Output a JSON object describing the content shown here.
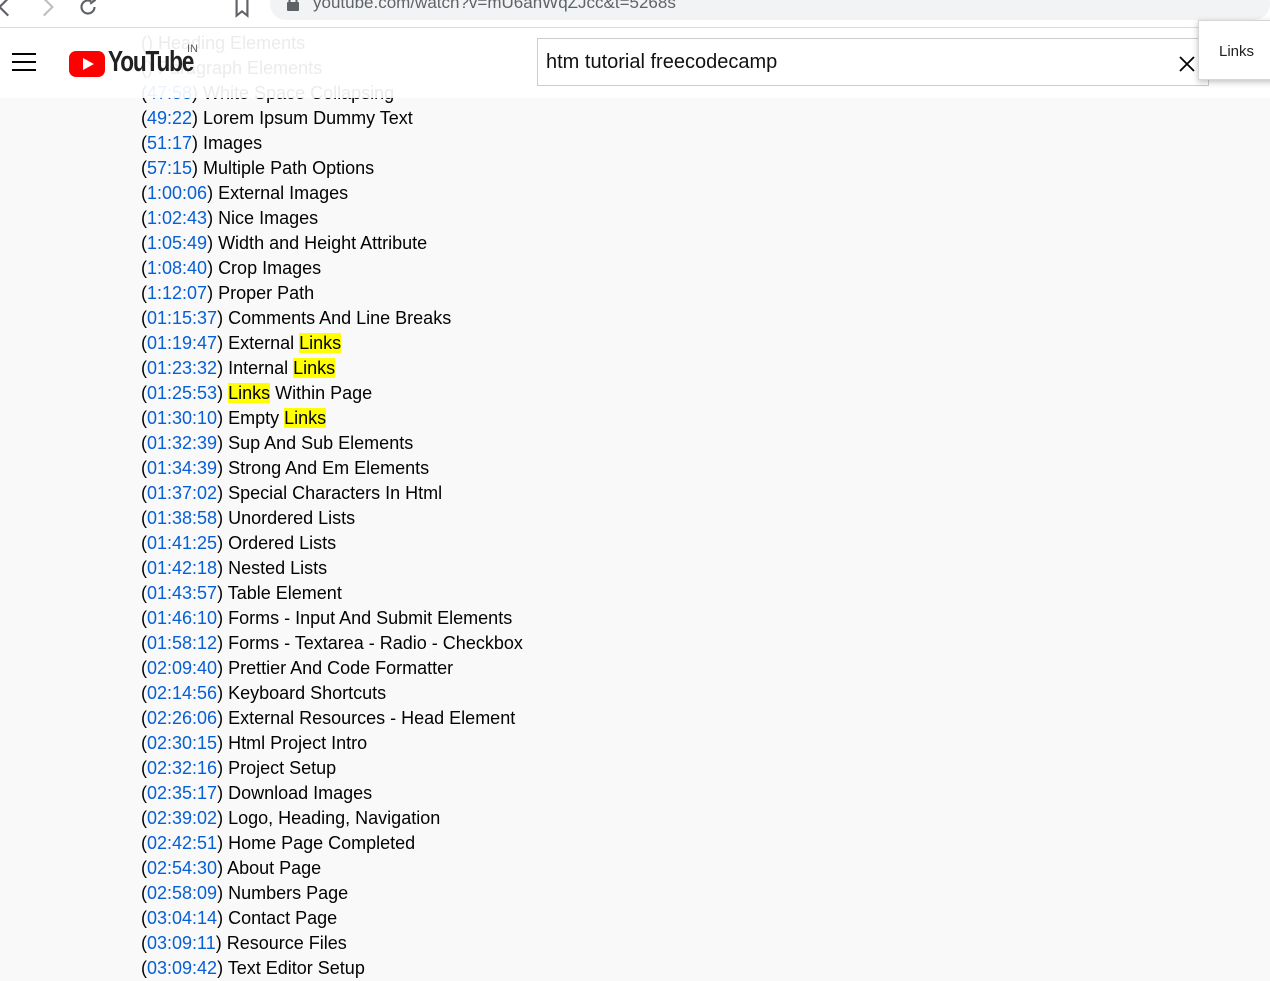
{
  "browser": {
    "url": "youtube.com/watch?v=mU6anWqZJcc&t=5268s"
  },
  "header": {
    "logo_text": "YouTube",
    "country_code": "IN",
    "search_value": "htm tutorial freecodecamp"
  },
  "find": {
    "query": "Links"
  },
  "chapters": [
    {
      "ts": "",
      "title": "Heading Elements"
    },
    {
      "ts": "",
      "title": "Paragraph Elements"
    },
    {
      "ts": "47:58",
      "title": "White Space Collapsing"
    },
    {
      "ts": "49:22",
      "title": "Lorem Ipsum Dummy Text"
    },
    {
      "ts": "51:17",
      "title": "Images"
    },
    {
      "ts": "57:15",
      "title": "Multiple Path Options"
    },
    {
      "ts": "1:00:06",
      "title": "External Images"
    },
    {
      "ts": "1:02:43",
      "title": "Nice Images"
    },
    {
      "ts": "1:05:49",
      "title": "Width and Height Attribute"
    },
    {
      "ts": "1:08:40",
      "title": "Crop Images"
    },
    {
      "ts": "1:12:07",
      "title": "Proper Path"
    },
    {
      "ts": "01:15:37",
      "title": "Comments And Line Breaks"
    },
    {
      "ts": "01:19:47",
      "title": "External Links"
    },
    {
      "ts": "01:23:32",
      "title": "Internal Links"
    },
    {
      "ts": "01:25:53",
      "title": "Links Within Page"
    },
    {
      "ts": "01:30:10",
      "title": "Empty Links"
    },
    {
      "ts": "01:32:39",
      "title": "Sup And Sub Elements"
    },
    {
      "ts": "01:34:39",
      "title": "Strong And Em Elements"
    },
    {
      "ts": "01:37:02",
      "title": "Special Characters In Html"
    },
    {
      "ts": "01:38:58",
      "title": "Unordered Lists"
    },
    {
      "ts": "01:41:25",
      "title": "Ordered Lists"
    },
    {
      "ts": "01:42:18",
      "title": "Nested Lists"
    },
    {
      "ts": "01:43:57",
      "title": "Table Element"
    },
    {
      "ts": "01:46:10",
      "title": "Forms - Input And Submit Elements"
    },
    {
      "ts": "01:58:12",
      "title": "Forms - Textarea - Radio - Checkbox"
    },
    {
      "ts": "02:09:40",
      "title": "Prettier And Code Formatter"
    },
    {
      "ts": "02:14:56",
      "title": "Keyboard Shortcuts"
    },
    {
      "ts": "02:26:06",
      "title": "External Resources - Head Element"
    },
    {
      "ts": "02:30:15",
      "title": "Html Project Intro"
    },
    {
      "ts": "02:32:16",
      "title": "Project Setup"
    },
    {
      "ts": "02:35:17",
      "title": "Download Images"
    },
    {
      "ts": "02:39:02",
      "title": "Logo, Heading, Navigation"
    },
    {
      "ts": "02:42:51",
      "title": "Home Page Completed"
    },
    {
      "ts": "02:54:30",
      "title": "About Page"
    },
    {
      "ts": "02:58:09",
      "title": "Numbers Page"
    },
    {
      "ts": "03:04:14",
      "title": "Contact Page"
    },
    {
      "ts": "03:09:11",
      "title": "Resource Files"
    },
    {
      "ts": "03:09:42",
      "title": "Text Editor Setup"
    }
  ]
}
